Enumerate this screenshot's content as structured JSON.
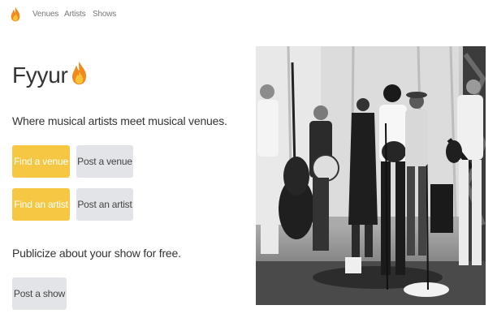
{
  "nav": {
    "logo_icon": "flame-icon",
    "links": [
      "Venues",
      "Artists",
      "Shows"
    ]
  },
  "hero": {
    "title": "Fyyur",
    "title_icon": "flame-icon",
    "tagline": "Where musical artists meet musical venues.",
    "buttons": {
      "find_venue": "Find a venue",
      "post_venue": "Post a venue",
      "find_artist": "Find an artist",
      "post_artist": "Post an artist"
    },
    "promo": "Publicize about your show for free.",
    "post_show": "Post a show"
  },
  "photo": {
    "subject": "band-performing-photo",
    "style": "black-and-white"
  },
  "colors": {
    "primary": "#f5c742",
    "secondary": "#e2e4e8",
    "text": "#333333",
    "nav_text": "#777777"
  }
}
